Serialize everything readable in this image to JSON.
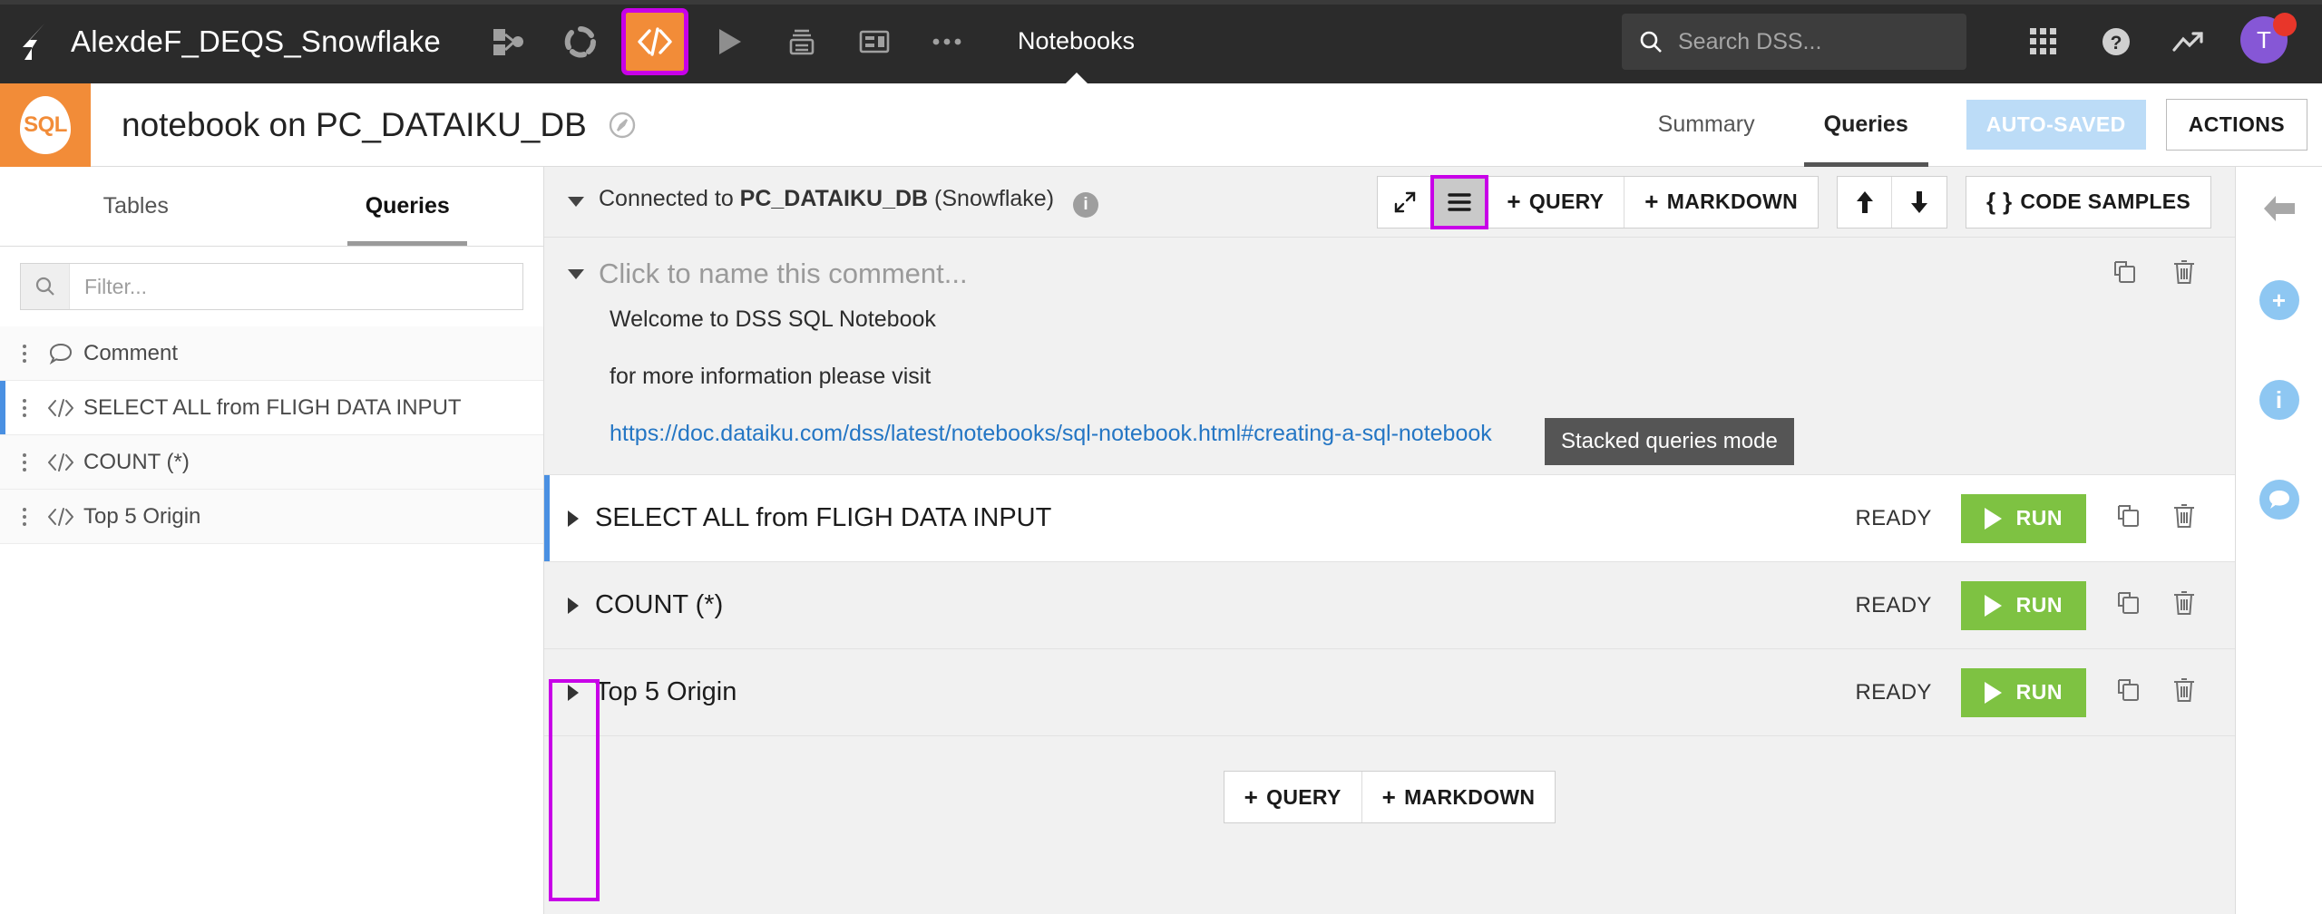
{
  "topbar": {
    "project_title": "AlexdeF_DEQS_Snowflake",
    "icons": [
      {
        "name": "flow-icon",
        "label": "Flow"
      },
      {
        "name": "lab-icon",
        "label": "Lab"
      },
      {
        "name": "code-icon",
        "label": "Code",
        "active": true
      },
      {
        "name": "run-icon",
        "label": "Run"
      },
      {
        "name": "printer-icon",
        "label": "Print"
      },
      {
        "name": "dashboard-icon",
        "label": "Dashboards"
      },
      {
        "name": "more-icon",
        "label": "More"
      }
    ],
    "nav_label": "Notebooks",
    "search": {
      "placeholder": "Search DSS..."
    },
    "avatar_initial": "T",
    "accent_orange": "#f28c38",
    "highlight_magenta": "#c800e8"
  },
  "subheader": {
    "logo_text": "SQL",
    "title": "notebook on PC_DATAIKU_DB",
    "tabs": [
      {
        "label": "Summary",
        "active": false
      },
      {
        "label": "Queries",
        "active": true
      }
    ],
    "autosaved_label": "AUTO-SAVED",
    "actions_label": "ACTIONS",
    "autosaved_color": "#bcdcf7"
  },
  "sidebar": {
    "tabs": [
      {
        "label": "Tables",
        "active": false
      },
      {
        "label": "Queries",
        "active": true
      }
    ],
    "filter": {
      "placeholder": "Filter...",
      "value": ""
    },
    "items": [
      {
        "label": "Comment",
        "icon": "comment-icon",
        "selected": false
      },
      {
        "label": "SELECT ALL from FLIGH DATA INPUT",
        "icon": "code-icon",
        "selected": true
      },
      {
        "label": "COUNT (*)",
        "icon": "code-icon",
        "selected": false
      },
      {
        "label": "Top 5 Origin",
        "icon": "code-icon",
        "selected": false
      }
    ]
  },
  "main": {
    "connection": {
      "prefix": "Connected to ",
      "name": "PC_DATAIKU_DB",
      "suffix": " (Snowflake)"
    },
    "toolbar": {
      "expand_label": "",
      "stacked_mode_label": "",
      "add_query_label": "QUERY",
      "add_markdown_label": "MARKDOWN",
      "code_samples_label": "CODE SAMPLES",
      "code_samples_prefix": "{ }"
    },
    "tooltip": "Stacked queries mode",
    "comment_cell": {
      "title_placeholder": "Click to name this comment...",
      "lines": [
        "Welcome to DSS SQL Notebook",
        "for more information please visit"
      ],
      "link": "https://doc.dataiku.com/dss/latest/notebooks/sql-notebook.html#creating-a-sql-notebook"
    },
    "queries": [
      {
        "name": "SELECT ALL from FLIGH DATA INPUT",
        "status": "READY",
        "run_label": "RUN",
        "selected": true
      },
      {
        "name": "COUNT (*)",
        "status": "READY",
        "run_label": "RUN",
        "selected": false
      },
      {
        "name": "Top 5 Origin",
        "status": "READY",
        "run_label": "RUN",
        "selected": false
      }
    ],
    "footer": {
      "add_query_label": "QUERY",
      "add_markdown_label": "MARKDOWN"
    },
    "run_button_color": "#7ec242"
  },
  "rail": {
    "items": [
      {
        "name": "collapse-arrow-icon"
      },
      {
        "name": "add-circle-icon",
        "glyph": "+"
      },
      {
        "name": "info-circle-icon",
        "glyph": "i"
      },
      {
        "name": "chat-circle-icon",
        "glyph": "●"
      }
    ]
  }
}
